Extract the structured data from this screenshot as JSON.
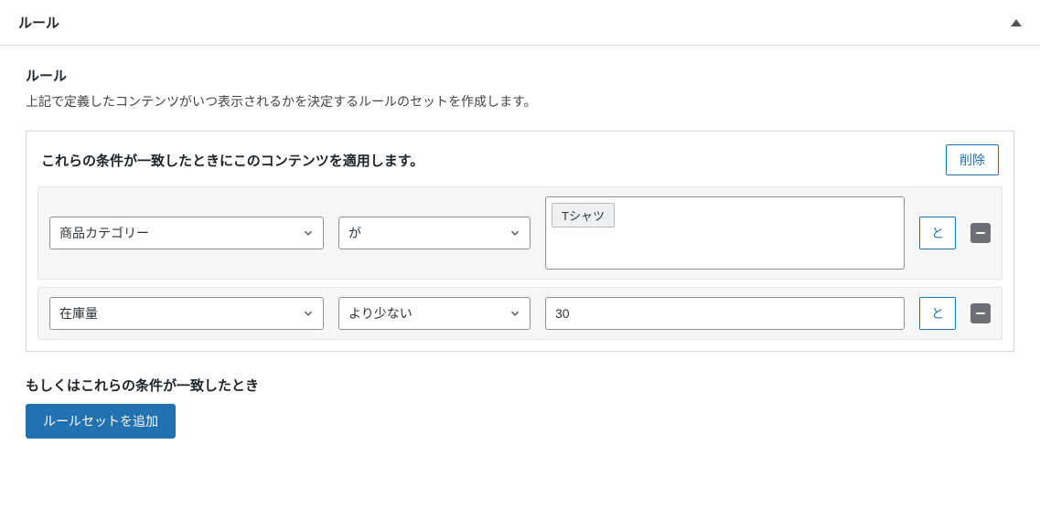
{
  "panel": {
    "title": "ルール"
  },
  "section": {
    "title": "ルール",
    "description": "上記で定義したコンテンツがいつ表示されるかを決定するルールのセットを作成します。"
  },
  "ruleset": {
    "header_text": "これらの条件が一致したときにこのコンテンツを適用します。",
    "delete_label": "削除"
  },
  "rules": [
    {
      "attribute": "商品カテゴリー",
      "operator": "が",
      "value_tag": "Tシャツ",
      "join_label": "と"
    },
    {
      "attribute": "在庫量",
      "operator": "より少ない",
      "value_text": "30",
      "join_label": "と"
    }
  ],
  "or_section": {
    "text": "もしくはこれらの条件が一致したとき",
    "add_button_label": "ルールセットを追加"
  }
}
